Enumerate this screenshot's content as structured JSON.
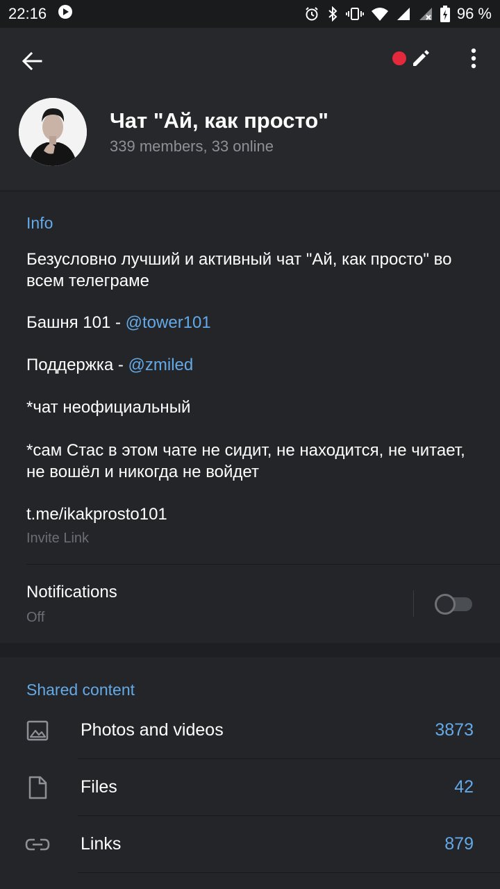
{
  "status_bar": {
    "time": "22:16",
    "battery": "96 %"
  },
  "header": {
    "title": "Чат \"Ай, как просто\"",
    "subtitle": "339 members, 33 online"
  },
  "info": {
    "section_title": "Info",
    "description_line1": "Безусловно лучший и активный чат \"Ай, как просто\" во всем телеграме",
    "tower_prefix": "Башня 101 - ",
    "tower_link": "@tower101",
    "support_prefix": "Поддержка - ",
    "support_link": "@zmiled",
    "note1": "*чат неофициальный",
    "note2": "*сам Стас в этом чате не сидит, не находится, не читает, не вошёл и никогда не войдет",
    "invite_link": "t.me/ikakprosto101",
    "invite_label": "Invite Link"
  },
  "notifications": {
    "title": "Notifications",
    "state": "Off"
  },
  "shared": {
    "section_title": "Shared content",
    "items": [
      {
        "label": "Photos and videos",
        "count": "3873",
        "icon": "image-icon"
      },
      {
        "label": "Files",
        "count": "42",
        "icon": "file-icon"
      },
      {
        "label": "Links",
        "count": "879",
        "icon": "link-icon"
      }
    ]
  },
  "colors": {
    "accent": "#64a9e8",
    "record": "#e3293b",
    "background": "#1d1f22",
    "header": "#26282b"
  }
}
